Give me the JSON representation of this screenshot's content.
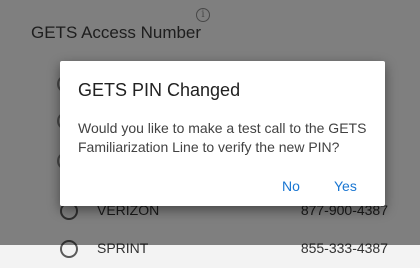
{
  "section": {
    "title": "GETS Access Number",
    "info_icon": "info-icon"
  },
  "carriers": [
    {
      "name": "VERIZON",
      "number": "877-900-4387"
    },
    {
      "name": "SPRINT",
      "number": "855-333-4387"
    }
  ],
  "dialog": {
    "title": "GETS PIN Changed",
    "message": "Would you like to make a test call to the GETS Familiarization Line to verify the new PIN?",
    "no_label": "No",
    "yes_label": "Yes"
  },
  "colors": {
    "accent": "#1976d2",
    "scrim": "rgba(0,0,0,0.48)"
  }
}
